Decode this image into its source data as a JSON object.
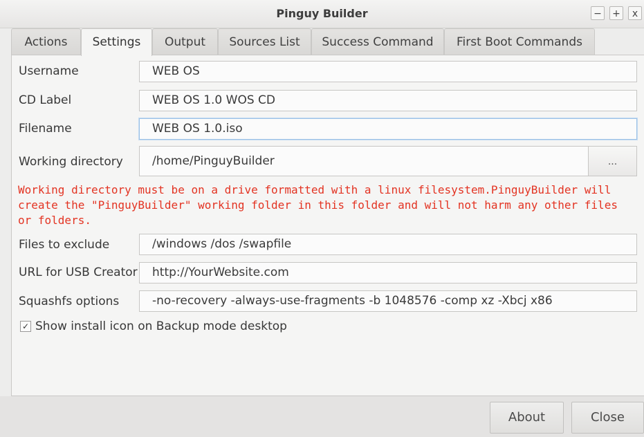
{
  "window": {
    "title": "Pinguy Builder",
    "minimize": "−",
    "maximize": "+",
    "close": "x"
  },
  "tabs": [
    {
      "label": "Actions",
      "active": false
    },
    {
      "label": "Settings",
      "active": true
    },
    {
      "label": "Output",
      "active": false
    },
    {
      "label": "Sources List",
      "active": false
    },
    {
      "label": "Success Command",
      "active": false
    },
    {
      "label": "First Boot Commands",
      "active": false
    }
  ],
  "settings": {
    "username": {
      "label": "Username",
      "value": "WEB OS"
    },
    "cd_label": {
      "label": "CD Label",
      "value": "WEB OS 1.0 WOS CD"
    },
    "filename": {
      "label": "Filename",
      "value": "WEB OS 1.0.iso"
    },
    "working_directory": {
      "label": "Working directory",
      "value": "/home/PinguyBuilder",
      "browse": "..."
    },
    "warning": "Working directory must be on a drive formatted with a linux filesystem.PinguyBuilder will create the \"PinguyBuilder\" working folder in this folder and will not harm any other files or folders.",
    "exclude": {
      "label": "Files to exclude",
      "value": "/windows /dos /swapfile"
    },
    "usb_url": {
      "label": "URL for USB Creator",
      "value": "http://YourWebsite.com"
    },
    "squashfs": {
      "label": "Squashfs options",
      "value": "-no-recovery -always-use-fragments -b 1048576 -comp xz -Xbcj x86"
    },
    "show_install_icon": {
      "label": "Show install icon on Backup mode desktop",
      "checked": true,
      "mark": "✓"
    }
  },
  "buttons": {
    "about": "About",
    "close": "Close"
  },
  "colors": {
    "warning": "#e33322",
    "focus_border": "#9bc1e6"
  }
}
